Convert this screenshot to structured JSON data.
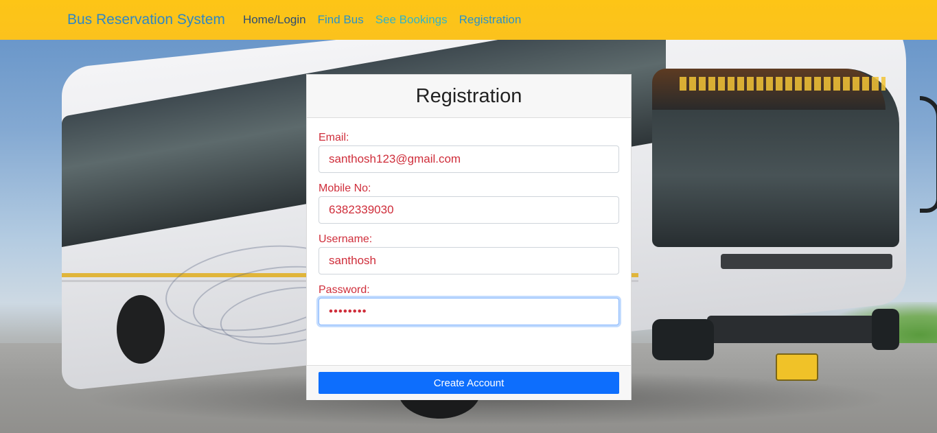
{
  "navbar": {
    "brand": "Bus Reservation System",
    "links": [
      {
        "label": "Home/Login"
      },
      {
        "label": "Find Bus"
      },
      {
        "label": "See Bookings"
      },
      {
        "label": "Registration"
      }
    ]
  },
  "form": {
    "title": "Registration",
    "email": {
      "label": "Email:",
      "value": "santhosh123@gmail.com"
    },
    "mobile": {
      "label": "Mobile No:",
      "value": "6382339030"
    },
    "username": {
      "label": "Username:",
      "value": "santhosh"
    },
    "password": {
      "label": "Password:",
      "masked_value": "••••••••"
    },
    "submit_label": "Create Account"
  },
  "colors": {
    "navbar_bg": "#fdc516",
    "brand": "#2f87c3",
    "label_red": "#cf2d3a",
    "primary_button": "#0d6efd"
  }
}
